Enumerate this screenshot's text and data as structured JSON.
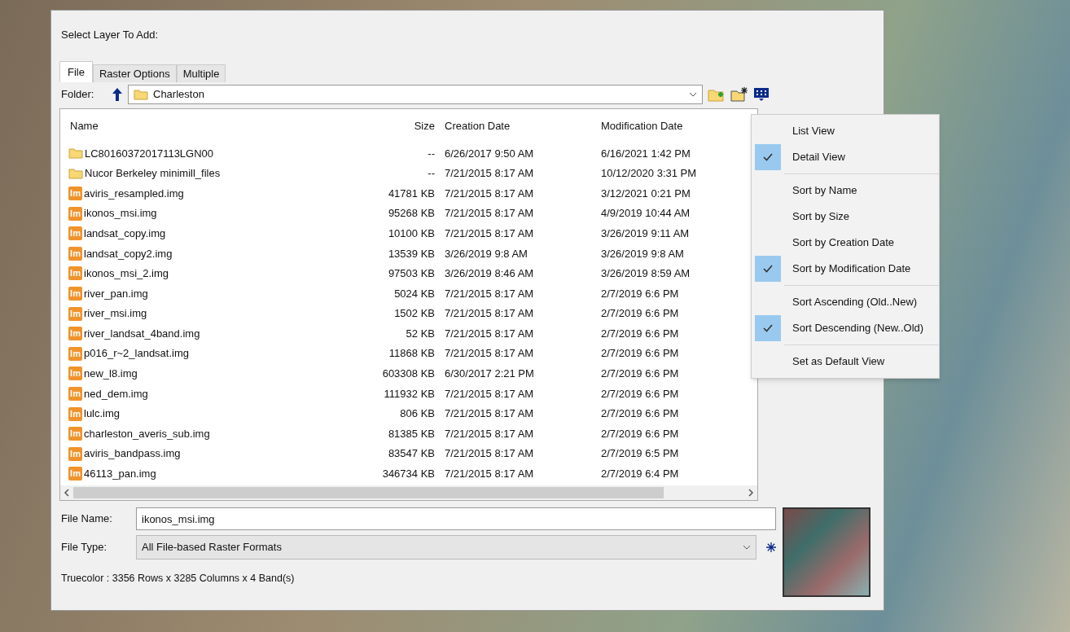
{
  "dialog": {
    "title": "Select Layer To Add:"
  },
  "tabs": [
    {
      "label": "File",
      "selected": true
    },
    {
      "label": "Raster Options",
      "selected": false
    },
    {
      "label": "Multiple",
      "selected": false
    }
  ],
  "folder": {
    "label": "Folder:",
    "value": "Charleston"
  },
  "table": {
    "columns": [
      "Name",
      "Size",
      "Creation Date",
      "Modification Date"
    ],
    "rows": [
      {
        "kind": "folder",
        "name": "LC80160372017113LGN00",
        "size": "--",
        "created": "6/26/2017 9:50 AM",
        "modified": "6/16/2021 1:42 PM"
      },
      {
        "kind": "folder",
        "name": "Nucor Berkeley minimill_files",
        "size": "--",
        "created": "7/21/2015 8:17 AM",
        "modified": "10/12/2020 3:31 PM"
      },
      {
        "kind": "image",
        "icon_label": "Im",
        "name": "aviris_resampled.img",
        "size": "41781 KB",
        "created": "7/21/2015 8:17 AM",
        "modified": "3/12/2021 0:21 PM"
      },
      {
        "kind": "image",
        "icon_label": "Im",
        "name": "ikonos_msi.img",
        "size": "95268 KB",
        "created": "7/21/2015 8:17 AM",
        "modified": "4/9/2019 10:44 AM"
      },
      {
        "kind": "image",
        "icon_label": "Im",
        "name": "landsat_copy.img",
        "size": "10100 KB",
        "created": "7/21/2015 8:17 AM",
        "modified": "3/26/2019 9:11 AM"
      },
      {
        "kind": "image",
        "icon_label": "Im",
        "name": "landsat_copy2.img",
        "size": "13539 KB",
        "created": "3/26/2019 9:8 AM",
        "modified": "3/26/2019 9:8 AM"
      },
      {
        "kind": "image",
        "icon_label": "Im",
        "name": "ikonos_msi_2.img",
        "size": "97503 KB",
        "created": "3/26/2019 8:46 AM",
        "modified": "3/26/2019 8:59 AM"
      },
      {
        "kind": "image",
        "icon_label": "Im",
        "name": "river_pan.img",
        "size": "5024 KB",
        "created": "7/21/2015 8:17 AM",
        "modified": "2/7/2019 6:6 PM"
      },
      {
        "kind": "image",
        "icon_label": "Im",
        "name": "river_msi.img",
        "size": "1502 KB",
        "created": "7/21/2015 8:17 AM",
        "modified": "2/7/2019 6:6 PM"
      },
      {
        "kind": "image",
        "icon_label": "Im",
        "name": "river_landsat_4band.img",
        "size": "52 KB",
        "created": "7/21/2015 8:17 AM",
        "modified": "2/7/2019 6:6 PM"
      },
      {
        "kind": "image",
        "icon_label": "Im",
        "name": "p016_r~2_landsat.img",
        "size": "11868 KB",
        "created": "7/21/2015 8:17 AM",
        "modified": "2/7/2019 6:6 PM"
      },
      {
        "kind": "image",
        "icon_label": "Im",
        "name": "new_l8.img",
        "size": "603308 KB",
        "created": "6/30/2017 2:21 PM",
        "modified": "2/7/2019 6:6 PM"
      },
      {
        "kind": "image",
        "icon_label": "Im",
        "name": "ned_dem.img",
        "size": "111932 KB",
        "created": "7/21/2015 8:17 AM",
        "modified": "2/7/2019 6:6 PM"
      },
      {
        "kind": "image",
        "icon_label": "Im",
        "name": "lulc.img",
        "size": "806 KB",
        "created": "7/21/2015 8:17 AM",
        "modified": "2/7/2019 6:6 PM"
      },
      {
        "kind": "image",
        "icon_label": "Im",
        "name": "charleston_averis_sub.img",
        "size": "81385 KB",
        "created": "7/21/2015 8:17 AM",
        "modified": "2/7/2019 6:6 PM"
      },
      {
        "kind": "image",
        "icon_label": "Im",
        "name": "aviris_bandpass.img",
        "size": "83547 KB",
        "created": "7/21/2015 8:17 AM",
        "modified": "2/7/2019 6:5 PM"
      },
      {
        "kind": "image",
        "icon_label": "Im",
        "name": "46113_pan.img",
        "size": "346734 KB",
        "created": "7/21/2015 8:17 AM",
        "modified": "2/7/2019 6:4 PM"
      }
    ]
  },
  "file_name": {
    "label": "File Name:",
    "value": "ikonos_msi.img"
  },
  "file_type": {
    "label": "File Type:",
    "value": "All File-based Raster Formats"
  },
  "info": "Truecolor : 3356 Rows x 3285 Columns x 4 Band(s)",
  "menu": [
    {
      "kind": "item",
      "label": "List View",
      "checked": false
    },
    {
      "kind": "item",
      "label": "Detail View",
      "checked": true
    },
    {
      "kind": "separator"
    },
    {
      "kind": "item",
      "label": "Sort by Name",
      "checked": false
    },
    {
      "kind": "item",
      "label": "Sort by Size",
      "checked": false
    },
    {
      "kind": "item",
      "label": "Sort by Creation Date",
      "checked": false
    },
    {
      "kind": "item",
      "label": "Sort by Modification Date",
      "checked": true
    },
    {
      "kind": "separator"
    },
    {
      "kind": "item",
      "label": "Sort Ascending (Old..New)",
      "checked": false
    },
    {
      "kind": "item",
      "label": "Sort Descending (New..Old)",
      "checked": true
    },
    {
      "kind": "separator"
    },
    {
      "kind": "item",
      "label": "Set as Default View",
      "checked": false
    }
  ]
}
